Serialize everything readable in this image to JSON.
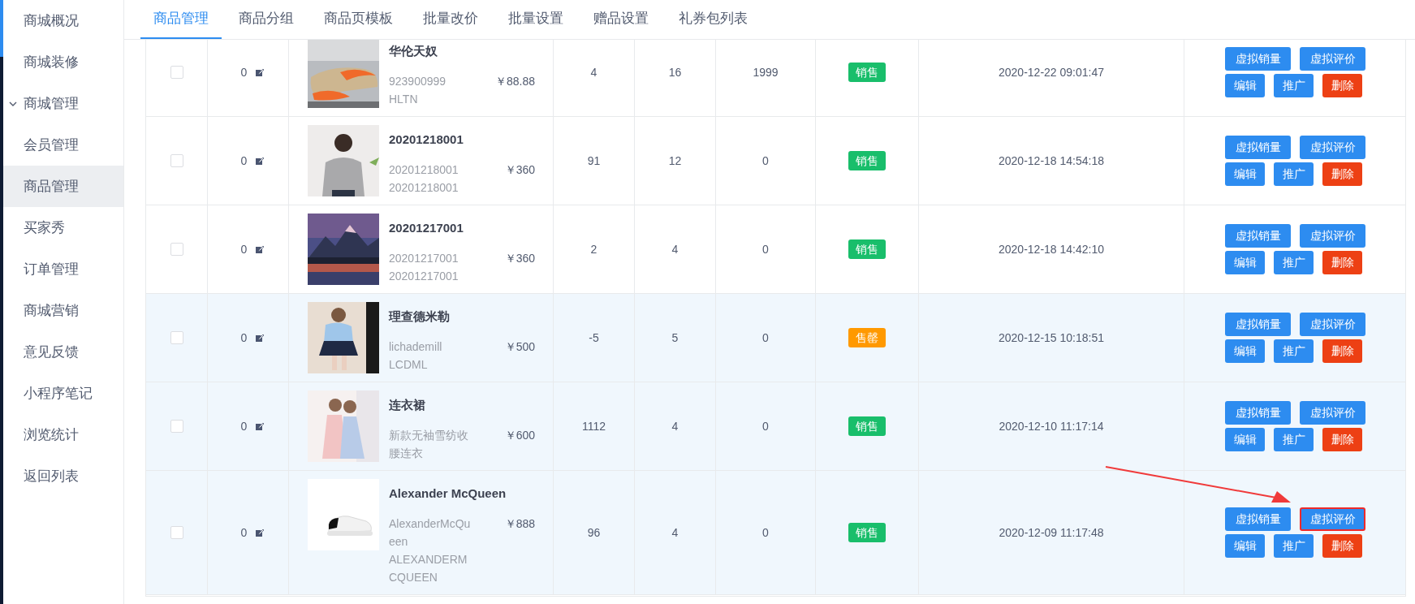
{
  "sidebar": {
    "items": [
      {
        "label": "商城概况",
        "kind": "link",
        "selected": false
      },
      {
        "label": "商城装修",
        "kind": "link",
        "selected": false
      },
      {
        "label": "商城管理",
        "kind": "group",
        "selected": false,
        "expanded": true
      },
      {
        "label": "会员管理",
        "kind": "link",
        "selected": false
      },
      {
        "label": "商品管理",
        "kind": "link",
        "selected": true
      },
      {
        "label": "买家秀",
        "kind": "link",
        "selected": false
      },
      {
        "label": "订单管理",
        "kind": "link",
        "selected": false
      },
      {
        "label": "商城营销",
        "kind": "link",
        "selected": false
      },
      {
        "label": "意见反馈",
        "kind": "link",
        "selected": false
      },
      {
        "label": "小程序笔记",
        "kind": "link",
        "selected": false
      },
      {
        "label": "浏览统计",
        "kind": "link",
        "selected": false
      },
      {
        "label": "返回列表",
        "kind": "link",
        "selected": false
      }
    ]
  },
  "tabs": [
    {
      "label": "商品管理",
      "selected": true
    },
    {
      "label": "商品分组",
      "selected": false
    },
    {
      "label": "商品页模板",
      "selected": false
    },
    {
      "label": "批量改价",
      "selected": false
    },
    {
      "label": "批量设置",
      "selected": false
    },
    {
      "label": "赠品设置",
      "selected": false
    },
    {
      "label": "礼券包列表",
      "selected": false
    }
  ],
  "table": {
    "rows": [
      {
        "checked": false,
        "highlighted": false,
        "sort": "0",
        "name": "华伦天奴",
        "code": "923900999",
        "sku": "HLTN",
        "price": "￥88.88",
        "column_4": "4",
        "column_5": "16",
        "column_6": "1999",
        "status": {
          "label": "销售",
          "kind": "on_sale"
        },
        "created": "2020-12-22 09:01:47",
        "buttons": [
          {
            "label": "虚拟销量",
            "kind": "primary",
            "highlighted": false
          },
          {
            "label": "虚拟评价",
            "kind": "primary",
            "highlighted": false
          },
          {
            "label": "编辑",
            "kind": "primary",
            "highlighted": false
          },
          {
            "label": "推广",
            "kind": "primary",
            "highlighted": false
          },
          {
            "label": "删除",
            "kind": "danger",
            "highlighted": false
          }
        ]
      },
      {
        "checked": false,
        "highlighted": false,
        "sort": "0",
        "name": "20201218001",
        "code": "20201218001",
        "sku": "20201218001",
        "price": "￥360",
        "column_4": "91",
        "column_5": "12",
        "column_6": "0",
        "status": {
          "label": "销售",
          "kind": "on_sale"
        },
        "created": "2020-12-18 14:54:18",
        "buttons": [
          {
            "label": "虚拟销量",
            "kind": "primary",
            "highlighted": false
          },
          {
            "label": "虚拟评价",
            "kind": "primary",
            "highlighted": false
          },
          {
            "label": "编辑",
            "kind": "primary",
            "highlighted": false
          },
          {
            "label": "推广",
            "kind": "primary",
            "highlighted": false
          },
          {
            "label": "删除",
            "kind": "danger",
            "highlighted": false
          }
        ]
      },
      {
        "checked": false,
        "highlighted": false,
        "sort": "0",
        "name": "20201217001",
        "code": "20201217001",
        "sku": "20201217001",
        "price": "￥360",
        "column_4": "2",
        "column_5": "4",
        "column_6": "0",
        "status": {
          "label": "销售",
          "kind": "on_sale"
        },
        "created": "2020-12-18 14:42:10",
        "buttons": [
          {
            "label": "虚拟销量",
            "kind": "primary",
            "highlighted": false
          },
          {
            "label": "虚拟评价",
            "kind": "primary",
            "highlighted": false
          },
          {
            "label": "编辑",
            "kind": "primary",
            "highlighted": false
          },
          {
            "label": "推广",
            "kind": "primary",
            "highlighted": false
          },
          {
            "label": "删除",
            "kind": "danger",
            "highlighted": false
          }
        ]
      },
      {
        "checked": false,
        "highlighted": true,
        "sort": "0",
        "name": "理查德米勒",
        "code": "lichademill",
        "sku": "LCDML",
        "price": "￥500",
        "column_4": "-5",
        "column_5": "5",
        "column_6": "0",
        "status": {
          "label": "售罄",
          "kind": "sold_out"
        },
        "created": "2020-12-15 10:18:51",
        "buttons": [
          {
            "label": "虚拟销量",
            "kind": "primary",
            "highlighted": false
          },
          {
            "label": "虚拟评价",
            "kind": "primary",
            "highlighted": false
          },
          {
            "label": "编辑",
            "kind": "primary",
            "highlighted": false
          },
          {
            "label": "推广",
            "kind": "primary",
            "highlighted": false
          },
          {
            "label": "删除",
            "kind": "danger",
            "highlighted": false
          }
        ]
      },
      {
        "checked": false,
        "highlighted": true,
        "sort": "0",
        "name": "连衣裙",
        "code": "新款无袖雪纺收腰连衣",
        "price": "￥600",
        "column_4": "1112",
        "column_5": "4",
        "column_6": "0",
        "status": {
          "label": "销售",
          "kind": "on_sale"
        },
        "created": "2020-12-10 11:17:14",
        "buttons": [
          {
            "label": "虚拟销量",
            "kind": "primary",
            "highlighted": false
          },
          {
            "label": "虚拟评价",
            "kind": "primary",
            "highlighted": false
          },
          {
            "label": "编辑",
            "kind": "primary",
            "highlighted": false
          },
          {
            "label": "推广",
            "kind": "primary",
            "highlighted": false
          },
          {
            "label": "删除",
            "kind": "danger",
            "highlighted": false
          }
        ]
      },
      {
        "checked": false,
        "highlighted": true,
        "sort": "0",
        "name": "Alexander McQueen",
        "code": "AlexanderMcQueen",
        "sku": "ALEXANDERMCQUEEN",
        "price": "￥888",
        "column_4": "96",
        "column_5": "4",
        "column_6": "0",
        "status": {
          "label": "销售",
          "kind": "on_sale"
        },
        "created": "2020-12-09 11:17:48",
        "buttons": [
          {
            "label": "虚拟销量",
            "kind": "primary",
            "highlighted": false
          },
          {
            "label": "虚拟评价",
            "kind": "primary",
            "highlighted": true
          },
          {
            "label": "编辑",
            "kind": "primary",
            "highlighted": false
          },
          {
            "label": "推广",
            "kind": "primary",
            "highlighted": false
          },
          {
            "label": "删除",
            "kind": "danger",
            "highlighted": false
          }
        ]
      }
    ]
  }
}
